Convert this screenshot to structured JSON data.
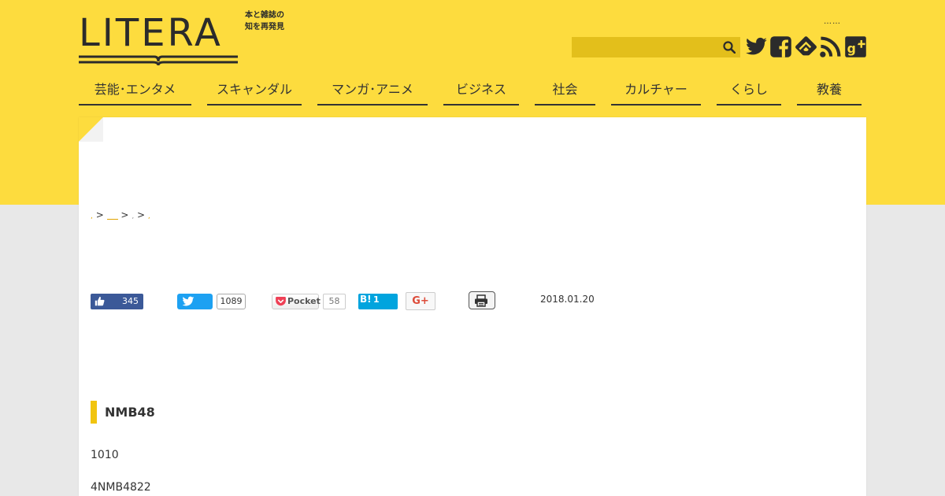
{
  "header": {
    "logo_text": "LITERA",
    "tagline_line1": "本と雑誌の",
    "tagline_line2": "知を再発見",
    "top_dots": "……",
    "search_value": "",
    "colors": {
      "band": "#fddc3e",
      "search": "#e3bf1b",
      "text": "#2b2b2b"
    },
    "social_icons": [
      "twitter-icon",
      "facebook-icon",
      "feedly-icon",
      "rss-icon",
      "google-plus-icon"
    ]
  },
  "nav": {
    "items": [
      {
        "label": "芸能･エンタメ"
      },
      {
        "label": "スキャンダル"
      },
      {
        "label": "マンガ･アニメ"
      },
      {
        "label": "ビジネス"
      },
      {
        "label": "社会"
      },
      {
        "label": "カルチャー"
      },
      {
        "label": "くらし"
      },
      {
        "label": "教養"
      }
    ]
  },
  "breadcrumb": {
    "items": [
      ",",
      ">",
      "",
      ">",
      ",",
      ">",
      ","
    ]
  },
  "share": {
    "like_count": "345",
    "tweet_count": "1089",
    "pocket_label": "Pocket",
    "pocket_count": "58",
    "hatena_label": "B!",
    "hatena_count": "1",
    "gplus_label": "G+",
    "colors": {
      "facebook": "#3b5998",
      "twitter": "#1da1f2",
      "pocket": "#ef4056",
      "hatena": "#00a4de",
      "gplus": "#dd4b39"
    }
  },
  "article": {
    "date": "2018.01.20",
    "section_title": "NMB48",
    "paragraphs": [
      "1010",
      "4NMB4822"
    ]
  }
}
